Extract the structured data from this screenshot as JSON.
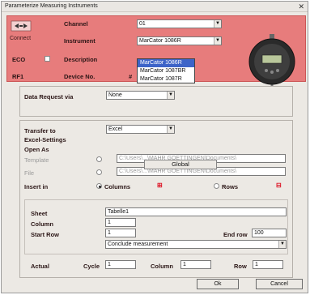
{
  "window": {
    "title": "Parameterize Measuring Instruments",
    "close_glyph": "✕"
  },
  "header": {
    "connect_label": "Connect",
    "channel_label": "Channel",
    "channel_value": "01",
    "instrument_label": "Instrument",
    "instrument_value": "MarCator 1086R",
    "description_label": "Description",
    "device_no_label": "Device No.",
    "eco_label": "ECO",
    "rf1_label": "RF1",
    "hash_label": "#",
    "dropdown_options": [
      "MarCator 1086R",
      "MarCator 1087BR",
      "MarCator 1087R"
    ],
    "dropdown_selected": "MarCator 1086R",
    "accent_color": "#e77c7c"
  },
  "data_request": {
    "label": "Data Request via",
    "value": "None"
  },
  "transfer": {
    "label": "Transfer to",
    "value": "Excel"
  },
  "excel": {
    "group_label": "Excel-Settings",
    "open_as_label": "Open As",
    "template_label": "Template",
    "template_path": "C:\\Users\\...\\MAHR GOETTINGEN\\Documents\\",
    "file_label": "File",
    "file_path": "C:\\Users\\...\\MAHR GOETTINGEN\\Documents\\",
    "global_label": "Global",
    "insert_in_label": "Insert in",
    "columns_label": "Columns",
    "rows_label": "Rows",
    "sheet_label": "Sheet",
    "sheet_value": "Tabelle1",
    "column_label": "Column",
    "column_value": "1",
    "start_row_label": "Start Row",
    "start_row_value": "1",
    "end_row_label": "End row",
    "end_row_value": "100",
    "conclude_value": "Conclude measurement",
    "actual_label": "Actual",
    "cycle_label": "Cycle",
    "cycle_value": "1",
    "actual_column_label": "Column",
    "actual_column_value": "1",
    "row_label": "Row",
    "row_value": "1"
  },
  "buttons": {
    "ok": "Ok",
    "cancel": "Cancel"
  }
}
